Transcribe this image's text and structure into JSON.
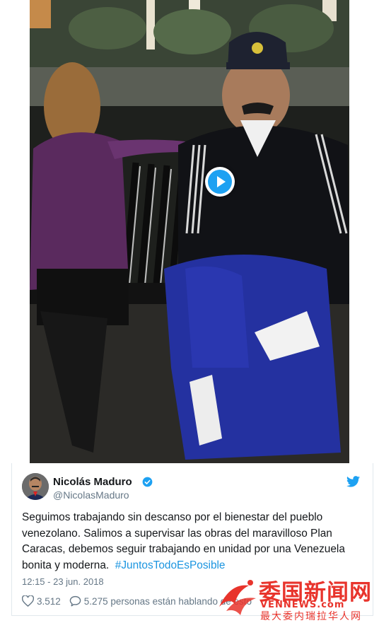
{
  "tweet": {
    "author_name": "Nicolás Maduro",
    "handle": "@NicolasMaduro",
    "text_before": "Seguimos trabajando sin descanso por el bienestar del pueblo venezolano. Salimos a supervisar las obras del maravilloso Plan Caracas, debemos seguir trabajando en unidad por una Venezuela bonita y moderna.",
    "hashtag": "#JuntosTodoEsPosible",
    "timestamp": "12:15 - 23 jun. 2018",
    "likes": "3.512",
    "conversation": "5.275 personas están hablando de esto"
  },
  "video": {
    "play_icon": "play-icon"
  },
  "watermark": {
    "chinese": "委国新闻网",
    "english": "VENNEWS.com",
    "subtitle": "最大委内瑞拉华人网"
  },
  "colors": {
    "twitter_blue": "#1da1f2",
    "hashtag": "#1b95e0",
    "muted": "#657786",
    "watermark_red": "#e8342c"
  }
}
